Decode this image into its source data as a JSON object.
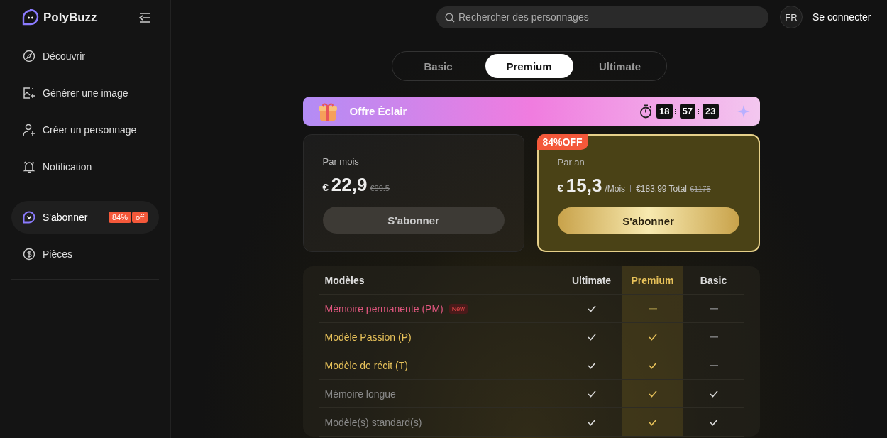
{
  "sidebar": {
    "brand": "PolyBuzz",
    "items": [
      {
        "label": "Découvrir",
        "selected": false
      },
      {
        "label": "Générer une image",
        "selected": false
      },
      {
        "label": "Créer un personnage",
        "selected": false
      },
      {
        "label": "Notification",
        "selected": false
      },
      {
        "label": "S'abonner",
        "selected": true,
        "badge": [
          "84%",
          "off"
        ]
      },
      {
        "label": "Pièces",
        "selected": false
      }
    ]
  },
  "header": {
    "search": {
      "placeholder": "Rechercher des personnages"
    },
    "language": "FR",
    "login": "Se connecter"
  },
  "tabs": [
    {
      "label": "Basic",
      "selected": false
    },
    {
      "label": "Premium",
      "selected": true
    },
    {
      "label": "Ultimate",
      "selected": false
    }
  ],
  "flash": {
    "title": "Offre Éclair",
    "timer": [
      "18",
      "57",
      "23"
    ]
  },
  "plans": [
    {
      "period": "Par mois",
      "currency": "€",
      "price": "22,9",
      "old_price": "€99.5",
      "button": "S'abonner",
      "selected": false
    },
    {
      "period": "Par an",
      "currency": "€",
      "price": "15,3",
      "unit": "/Mois",
      "total": "€183,99 Total",
      "old_price": "€1175",
      "badge": "84%OFF",
      "button": "S'abonner",
      "selected": true
    }
  ],
  "table": {
    "columns": [
      {
        "label": "Modèles",
        "selected": false
      },
      {
        "label": "Ultimate",
        "selected": false
      },
      {
        "label": "Premium",
        "selected": true
      },
      {
        "label": "Basic",
        "selected": false
      }
    ],
    "rows": [
      {
        "label": "Mémoire permanente (PM)",
        "kind": "new",
        "badge": "New",
        "checks": [
          true,
          false,
          false
        ]
      },
      {
        "label": "Modèle Passion (P)",
        "kind": "premium",
        "checks": [
          true,
          true,
          false
        ]
      },
      {
        "label": "Modèle de récit (T)",
        "kind": "premium",
        "checks": [
          true,
          true,
          false
        ]
      },
      {
        "label": "Mémoire longue",
        "kind": "standard",
        "checks": [
          true,
          true,
          true
        ]
      },
      {
        "label": "Modèle(s) standard(s)",
        "kind": "standard",
        "checks": [
          true,
          true,
          true
        ]
      }
    ]
  }
}
